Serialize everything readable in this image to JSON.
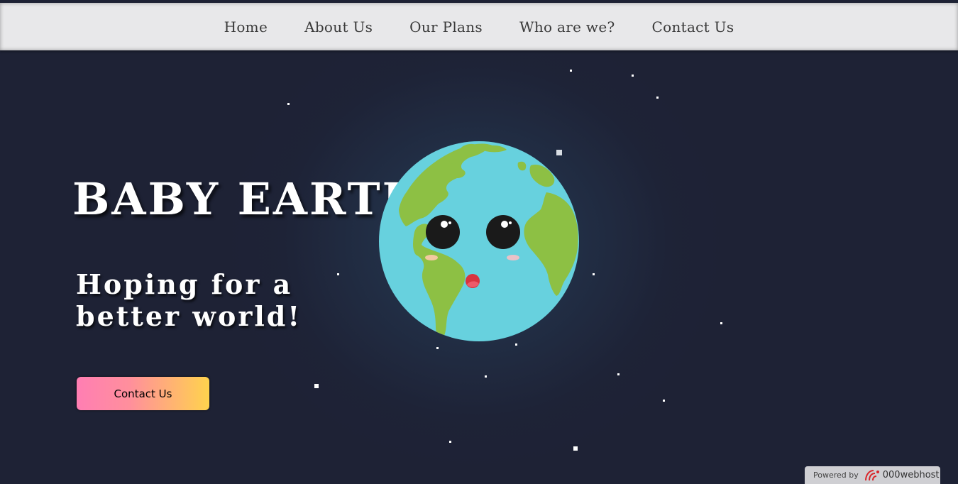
{
  "nav": {
    "items": [
      "Home",
      "About Us",
      "Our Plans",
      "Who are we?",
      "Contact Us"
    ]
  },
  "hero": {
    "title": "BABY EARTH",
    "subtitle_line1": "Hoping for a",
    "subtitle_line2": "better world!",
    "cta_label": "Contact Us"
  },
  "footer_badge": {
    "prefix": "Powered by",
    "brand": "000webhost"
  },
  "colors": {
    "background": "#1e2235",
    "nav_background": "#e8e8ea",
    "ocean": "#67d1de",
    "land": "#8dc044",
    "cta_gradient_start": "#ff7eb3",
    "cta_gradient_end": "#ffd34d"
  },
  "icons": {
    "earth": "earth-illustration-icon",
    "badge_logo": "000webhost-logo-icon"
  }
}
